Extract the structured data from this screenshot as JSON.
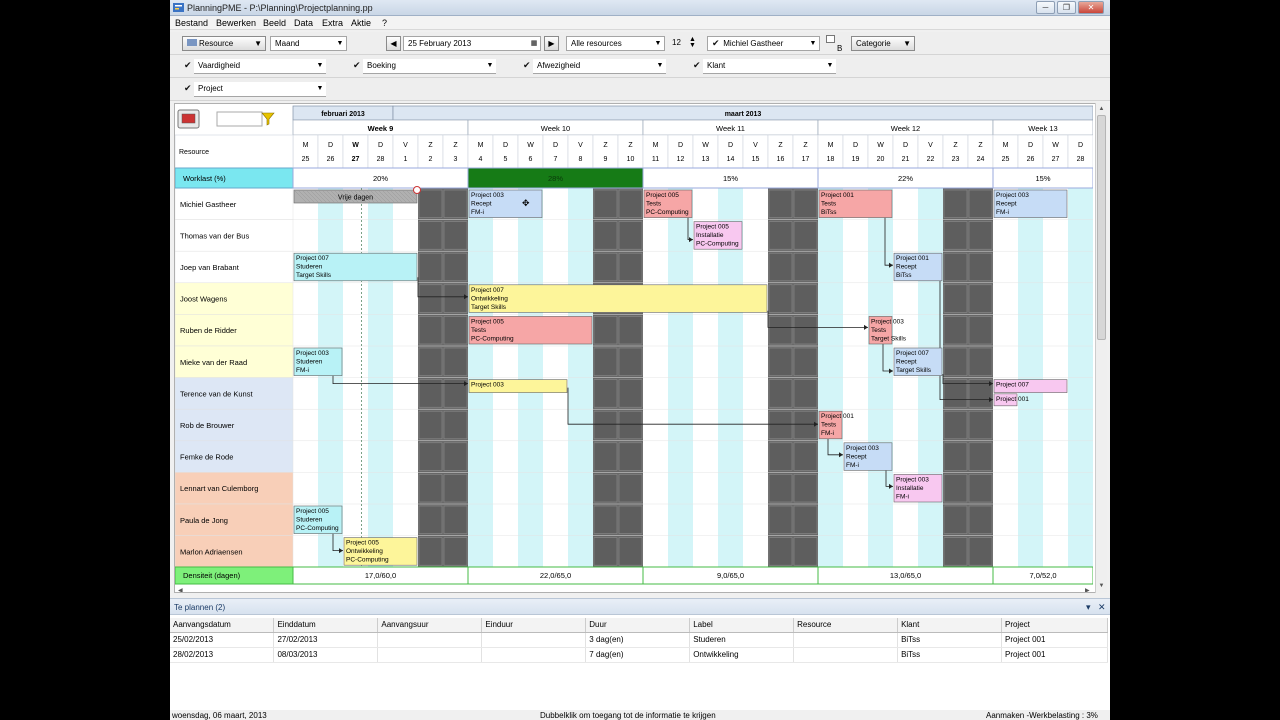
{
  "window": {
    "title": "PlanningPME - P:\\Planning\\Projectplanning.pp",
    "controls": [
      "─",
      "❐",
      "✕"
    ]
  },
  "menu": [
    "Bestand",
    "Bewerken",
    "Beeld",
    "Data",
    "Extra",
    "Aktie",
    "?"
  ],
  "toolbar": {
    "resource_btn": "Resource",
    "view": "Maand",
    "date": "25  February  2013",
    "resources_filter": "Alle resources",
    "count": "12",
    "person": "Michiel Gastheer",
    "category": "Categorie",
    "b_label": "B"
  },
  "filters": {
    "vaardigheid": "Vaardigheid",
    "boeking": "Boeking",
    "afwezigheid": "Afwezigheid",
    "klant": "Klant",
    "project": "Project"
  },
  "calendar": {
    "months": [
      {
        "label": "februari 2013",
        "start": 0,
        "count": 4
      },
      {
        "label": "maart 2013",
        "start": 4,
        "count": 28
      }
    ],
    "weeks": [
      {
        "label": "Week 9",
        "start": 0,
        "count": 7
      },
      {
        "label": "Week 10",
        "start": 7,
        "count": 7
      },
      {
        "label": "Week 11",
        "start": 14,
        "count": 7
      },
      {
        "label": "Week 12",
        "start": 21,
        "count": 7
      },
      {
        "label": "Week 13",
        "start": 28,
        "count": 4
      }
    ],
    "days": [
      {
        "l": "M",
        "n": "25"
      },
      {
        "l": "D",
        "n": "26"
      },
      {
        "l": "W",
        "n": "27",
        "today": true
      },
      {
        "l": "D",
        "n": "28"
      },
      {
        "l": "V",
        "n": "1"
      },
      {
        "l": "Z",
        "n": "2"
      },
      {
        "l": "Z",
        "n": "3"
      },
      {
        "l": "M",
        "n": "4"
      },
      {
        "l": "D",
        "n": "5"
      },
      {
        "l": "W",
        "n": "6"
      },
      {
        "l": "D",
        "n": "7"
      },
      {
        "l": "V",
        "n": "8"
      },
      {
        "l": "Z",
        "n": "9"
      },
      {
        "l": "Z",
        "n": "10"
      },
      {
        "l": "M",
        "n": "11"
      },
      {
        "l": "D",
        "n": "12"
      },
      {
        "l": "W",
        "n": "13"
      },
      {
        "l": "D",
        "n": "14"
      },
      {
        "l": "V",
        "n": "15"
      },
      {
        "l": "Z",
        "n": "16"
      },
      {
        "l": "Z",
        "n": "17"
      },
      {
        "l": "M",
        "n": "18"
      },
      {
        "l": "D",
        "n": "19"
      },
      {
        "l": "W",
        "n": "20"
      },
      {
        "l": "D",
        "n": "21"
      },
      {
        "l": "V",
        "n": "22"
      },
      {
        "l": "Z",
        "n": "23"
      },
      {
        "l": "Z",
        "n": "24"
      },
      {
        "l": "M",
        "n": "25"
      },
      {
        "l": "D",
        "n": "26"
      },
      {
        "l": "W",
        "n": "27"
      },
      {
        "l": "D",
        "n": "28"
      }
    ],
    "resource_header": "Resource",
    "workload_label": "Worklast (%)",
    "workload": [
      {
        "week": 0,
        "value": "20%"
      },
      {
        "week": 1,
        "value": "28%",
        "highlight": true
      },
      {
        "week": 2,
        "value": "15%"
      },
      {
        "week": 3,
        "value": "22%"
      },
      {
        "week": 4,
        "value": "15%"
      }
    ],
    "density_label": "Densiteit (dagen)",
    "density": [
      "17,0/60,0",
      "22,0/65,0",
      "9,0/65,0",
      "13,0/65,0",
      "7,0/52,0"
    ]
  },
  "resources": [
    {
      "name": "Michiel Gastheer",
      "color": "#ffffff"
    },
    {
      "name": "Thomas van der Bus",
      "color": "#ffffff"
    },
    {
      "name": "Joep van Brabant",
      "color": "#ffffff"
    },
    {
      "name": "Joost Wagens",
      "color": "#ffffd6"
    },
    {
      "name": "Ruben de Ridder",
      "color": "#ffffd6"
    },
    {
      "name": "Mieke van der Raad",
      "color": "#ffffd6"
    },
    {
      "name": "Terence van de Kunst",
      "color": "#dde7f5"
    },
    {
      "name": "Rob de Brouwer",
      "color": "#dde7f5"
    },
    {
      "name": "Femke de Rode",
      "color": "#dde7f5"
    },
    {
      "name": "Lennart van Culemborg",
      "color": "#f8cfb8"
    },
    {
      "name": "Paula de Jong",
      "color": "#f8cfb8"
    },
    {
      "name": "Marlon Adriaensen",
      "color": "#f8cfb8"
    }
  ],
  "tasks": [
    {
      "row": 0,
      "start": 0,
      "dur": 5,
      "lines": [
        "Vrije dagen"
      ],
      "color": "#b0b0b0",
      "hatch": true
    },
    {
      "row": 0,
      "start": 7,
      "dur": 3,
      "lines": [
        "Project 003",
        "Recept",
        "FM-i"
      ],
      "color": "#c6dcf6"
    },
    {
      "row": 0,
      "start": 14,
      "dur": 2,
      "lines": [
        "Project 005",
        "Tests",
        "PC-Computing"
      ],
      "color": "#f6a6a6"
    },
    {
      "row": 0,
      "start": 21,
      "dur": 3,
      "lines": [
        "Project 001",
        "Tests",
        "BiTss"
      ],
      "color": "#f6a6a6"
    },
    {
      "row": 0,
      "start": 28,
      "dur": 3,
      "lines": [
        "Project 003",
        "Recept",
        "FM-i"
      ],
      "color": "#c6dcf6"
    },
    {
      "row": 1,
      "start": 16,
      "dur": 2,
      "lines": [
        "Project 005",
        "Installatie",
        "PC-Computing"
      ],
      "color": "#f8c8f0"
    },
    {
      "row": 2,
      "start": 0,
      "dur": 5,
      "lines": [
        "Project 007",
        "Studeren",
        "Target Skills"
      ],
      "color": "#b8f2f6"
    },
    {
      "row": 2,
      "start": 24,
      "dur": 2,
      "lines": [
        "Project 001",
        "Recept",
        "BiTss"
      ],
      "color": "#c6dcf6"
    },
    {
      "row": 3,
      "start": 7,
      "dur": 12,
      "lines": [
        "Project 007",
        "Ontwikkeling",
        "Target Skills"
      ],
      "color": "#fdf59a"
    },
    {
      "row": 4,
      "start": 7,
      "dur": 5,
      "lines": [
        "Project 005",
        "Tests",
        "PC-Computing"
      ],
      "color": "#f6a6a6"
    },
    {
      "row": 4,
      "start": 23,
      "dur": 1,
      "lines": [
        "Project 003",
        "Tests",
        "Target Skills"
      ],
      "color": "#f6a6a6"
    },
    {
      "row": 5,
      "start": 0,
      "dur": 2,
      "lines": [
        "Project 003",
        "Studeren",
        "FM-i"
      ],
      "color": "#b8f2f6"
    },
    {
      "row": 5,
      "start": 24,
      "dur": 2,
      "lines": [
        "Project 007",
        "Recept",
        "Target Skills"
      ],
      "color": "#c6dcf6"
    },
    {
      "row": 6,
      "start": 7,
      "dur": 4,
      "lines": [
        "Project 003"
      ],
      "color": "#fdf59a"
    },
    {
      "row": 6,
      "start": 28,
      "dur": 3,
      "lines": [
        "Project 007"
      ],
      "color": "#f8c8f0"
    },
    {
      "row": 6.45,
      "start": 28,
      "dur": 1,
      "lines": [
        "Project 001"
      ],
      "color": "#f8c8f0",
      "small": true
    },
    {
      "row": 7,
      "start": 21,
      "dur": 1,
      "lines": [
        "Project 001",
        "Tests",
        "FM-i"
      ],
      "color": "#f6a6a6"
    },
    {
      "row": 8,
      "start": 22,
      "dur": 2,
      "lines": [
        "Project 003",
        "Recept",
        "FM-i"
      ],
      "color": "#c6dcf6"
    },
    {
      "row": 9,
      "start": 24,
      "dur": 2,
      "lines": [
        "Project 003",
        "Installatie",
        "FM-i"
      ],
      "color": "#f8c8f0"
    },
    {
      "row": 10,
      "start": 0,
      "dur": 2,
      "lines": [
        "Project 005",
        "Studeren",
        "PC-Computing"
      ],
      "color": "#b8f2f6"
    },
    {
      "row": 11,
      "start": 2,
      "dur": 3,
      "lines": [
        "Project 005",
        "Ontwikkeling",
        "PC-Computing"
      ],
      "color": "#fdf59a"
    }
  ],
  "te_plannen": {
    "title": "Te plannen (2)",
    "columns": [
      "Aanvangsdatum",
      "Einddatum",
      "Aanvangsuur",
      "Einduur",
      "Duur",
      "Label",
      "Resource",
      "Klant",
      "Project"
    ],
    "rows": [
      [
        "25/02/2013",
        "27/02/2013",
        "",
        "",
        "3 dag(en)",
        "Studeren",
        "",
        "BiTss",
        "Project 001"
      ],
      [
        "28/02/2013",
        "08/03/2013",
        "",
        "",
        "7 dag(en)",
        "Ontwikkeling",
        "",
        "BiTss",
        "Project 001"
      ]
    ]
  },
  "status": {
    "left": "woensdag, 06 maart, 2013",
    "center": "Dubbelklik om toegang tot de informatie te krijgen",
    "right": "Aanmaken -Werkbelasting : 3%"
  },
  "colors": {
    "weekend": "#676767",
    "alt_col": "#d3f5f8",
    "workload_label_bg": "#7ae7f0",
    "workload_highlight": "#167b16",
    "density_label_bg": "#7ef07a"
  }
}
